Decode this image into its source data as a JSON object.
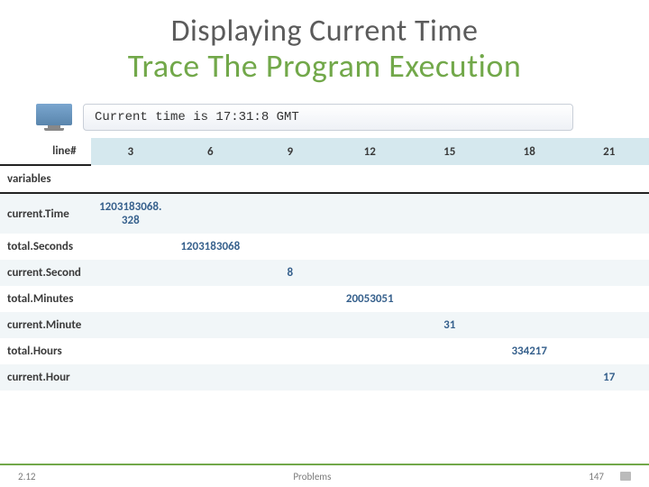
{
  "title_line1": "Displaying Current Time",
  "title_line2": "Trace The Program Execution",
  "output_text": "Current time is 17:31:8 GMT",
  "columns_header_label": "line#",
  "columns": [
    "3",
    "6",
    "9",
    "12",
    "15",
    "18",
    "21"
  ],
  "variables_row_label": "variables",
  "rows": [
    {
      "label": "current.Time",
      "col": 0,
      "value": "1203183068. 328"
    },
    {
      "label": "total.Seconds",
      "col": 1,
      "value": "1203183068"
    },
    {
      "label": "current.Second",
      "col": 2,
      "value": "8"
    },
    {
      "label": "total.Minutes",
      "col": 3,
      "value": "20053051"
    },
    {
      "label": "current.Minute",
      "col": 4,
      "value": "31"
    },
    {
      "label": "total.Hours",
      "col": 5,
      "value": "334217"
    },
    {
      "label": "current.Hour",
      "col": 6,
      "value": "17"
    }
  ],
  "footer": {
    "left": "2.12",
    "center": "Problems",
    "page": "147"
  }
}
